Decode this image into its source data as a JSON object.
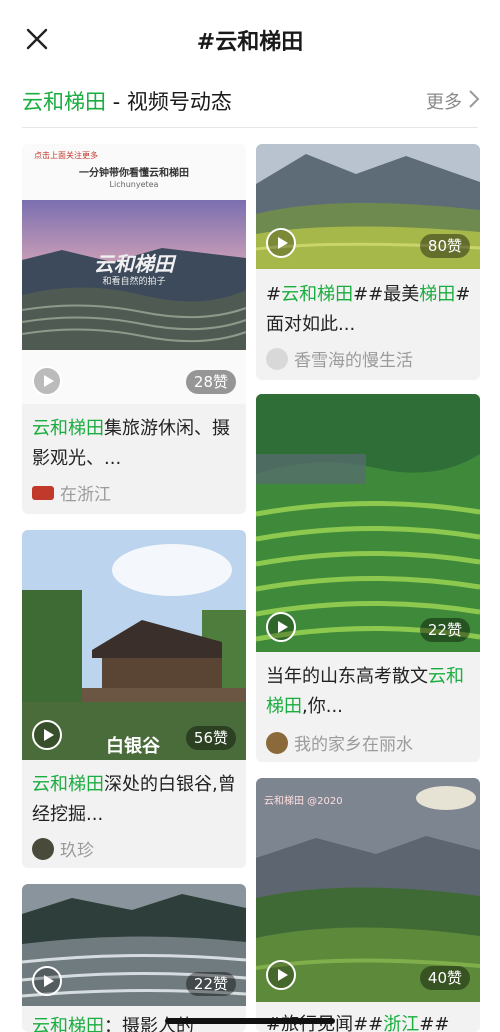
{
  "header": {
    "title": "#云和梯田",
    "close_icon": "close-icon"
  },
  "section": {
    "title_hl": "云和梯田",
    "title_rest": " - 视频号动态",
    "more_label": "更多"
  },
  "cards": [
    {
      "thumb_top": "点击上面关注更多",
      "thumb_caption": "一分钟带你看懂云和梯田",
      "thumb_brand": "Lichunyetea",
      "thumb_scene_title": "云和梯田",
      "thumb_scene_sub": "和看自然的拍子",
      "likes": "28赞",
      "title_hl": "云和梯田",
      "title_rest": "集旅游休闲、摄影观光、...",
      "author": "在浙江"
    },
    {
      "likes": "80赞",
      "title_a": "#",
      "title_hl1": "云和梯田",
      "title_b": "##最美",
      "title_hl2": "梯田",
      "title_c": "# 面对如此...",
      "author": "香雪海的慢生活"
    },
    {
      "likes": "22赞",
      "title_a": "当年的山东高考散文",
      "title_hl": "云和梯田",
      "title_b": ",你...",
      "author": "我的家乡在丽水"
    },
    {
      "thumb_label": "白银谷",
      "likes": "56赞",
      "title_hl": "云和梯田",
      "title_rest": "深处的白银谷,曾经挖掘...",
      "author": "玖珍"
    },
    {
      "thumb_watermark": "云和梯田 @2020",
      "likes": "40赞",
      "title_a": "#旅行见闻##",
      "title_hl": "浙江",
      "title_b": "##"
    },
    {
      "likes": "22赞",
      "title_hl": "云和梯田",
      "title_rest": "：摄影人的"
    }
  ],
  "colors": {
    "accent": "#1aad3f",
    "muted": "#8a8a8a",
    "card_bg": "#f2f2f2"
  }
}
